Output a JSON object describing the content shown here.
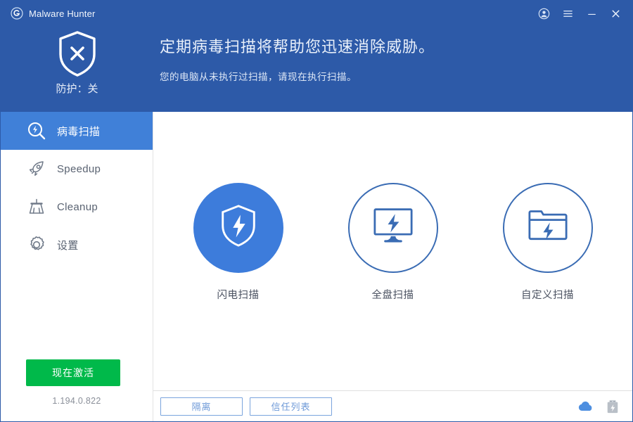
{
  "window": {
    "title": "Malware Hunter",
    "logo_icon": "shield-g-logo-icon",
    "controls": [
      {
        "name": "account-icon",
        "label": "Account"
      },
      {
        "name": "menu-icon",
        "label": "Menu"
      },
      {
        "name": "minimize-icon",
        "label": "Minimize"
      },
      {
        "name": "close-icon",
        "label": "Close"
      }
    ]
  },
  "banner": {
    "shield_icon": "shield-x-icon",
    "protection_status": "防护：关",
    "title": "定期病毒扫描将帮助您迅速消除威胁。",
    "subtitle": "您的电脑从未执行过扫描，请现在执行扫描。"
  },
  "sidebar": {
    "items": [
      {
        "label": "病毒扫描",
        "icon": "scan-magnifier-bolt-icon",
        "active": true
      },
      {
        "label": "Speedup",
        "icon": "rocket-icon",
        "active": false
      },
      {
        "label": "Cleanup",
        "icon": "broom-icon",
        "active": false
      },
      {
        "label": "设置",
        "icon": "gear-icon",
        "active": false
      }
    ],
    "activate_button": "现在激活",
    "version": "1.194.0.822"
  },
  "main": {
    "scan_options": [
      {
        "label": "闪电扫描",
        "icon": "shield-bolt-icon",
        "style": "filled"
      },
      {
        "label": "全盘扫描",
        "icon": "monitor-bolt-icon",
        "style": "outline"
      },
      {
        "label": "自定义扫描",
        "icon": "folder-bolt-icon",
        "style": "outline"
      }
    ]
  },
  "bottom_bar": {
    "quarantine_button": "隔离",
    "trust_list_button": "信任列表",
    "icons": [
      {
        "name": "cloud-icon"
      },
      {
        "name": "usb-bolt-icon"
      }
    ]
  },
  "colors": {
    "title_bar": "#2d5aa8",
    "banner": "#2d5aa8",
    "sidebar_active": "#4080d8",
    "accent_blue": "#3d7cdb",
    "activate_green": "#00b94a",
    "outline_blue": "#3a6cb4",
    "ghost_button_border": "#7aa4dd"
  }
}
